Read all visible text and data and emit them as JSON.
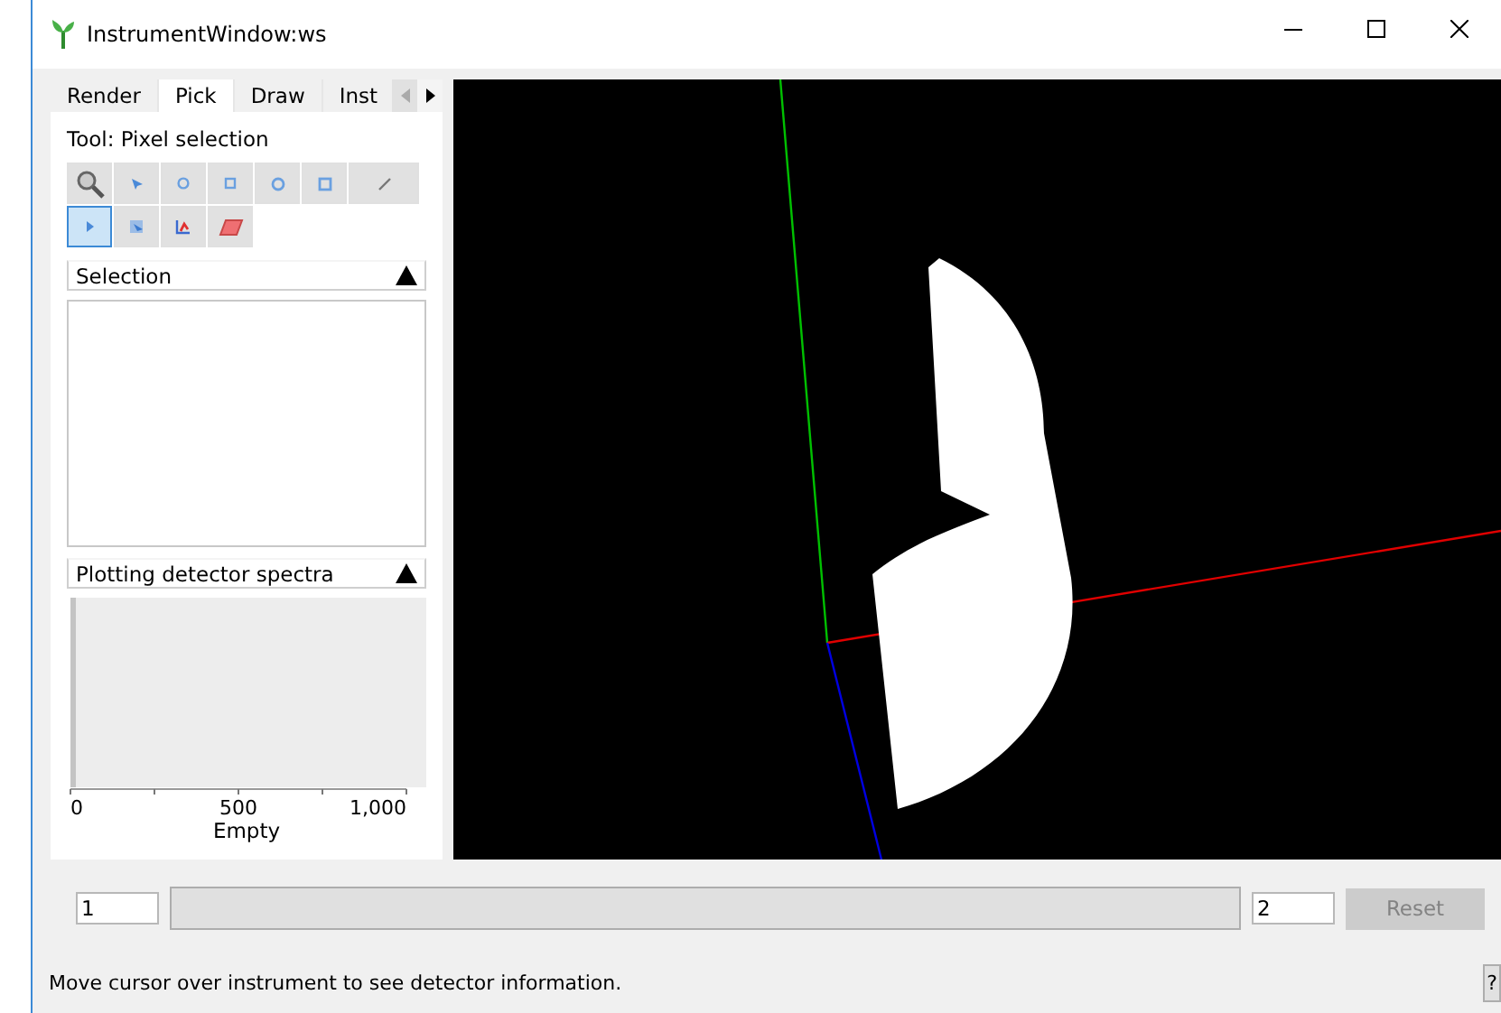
{
  "window": {
    "title": "InstrumentWindow:ws"
  },
  "tabs": [
    {
      "label": "Render",
      "selected": false
    },
    {
      "label": "Pick",
      "selected": true
    },
    {
      "label": "Draw",
      "selected": false
    },
    {
      "label": "Inst",
      "selected": false
    }
  ],
  "tool_label": "Tool: Pixel selection",
  "tools": [
    [
      {
        "kind": "zoom",
        "selected": false
      },
      {
        "kind": "pick",
        "selected": false
      },
      {
        "kind": "ellipse",
        "selected": false
      },
      {
        "kind": "rect",
        "selected": false
      },
      {
        "kind": "ring",
        "selected": false
      },
      {
        "kind": "rectring",
        "selected": false
      },
      {
        "kind": "line",
        "selected": false
      }
    ],
    [
      {
        "kind": "pixel",
        "selected": true
      },
      {
        "kind": "tube",
        "selected": false
      },
      {
        "kind": "peak",
        "selected": false
      },
      {
        "kind": "erase",
        "selected": false
      }
    ]
  ],
  "selection": {
    "title": "Selection",
    "expanded": true
  },
  "plot": {
    "title": "Plotting detector spectra",
    "expanded": true,
    "axis_labels": [
      "0",
      "500",
      "1,000"
    ],
    "axis_title": "Empty"
  },
  "range": {
    "min": "1",
    "max": "2",
    "reset": {
      "label": "Reset",
      "disabled": true
    }
  },
  "status_bar": {
    "text": "Move cursor over instrument to see detector information.",
    "help": "?"
  }
}
